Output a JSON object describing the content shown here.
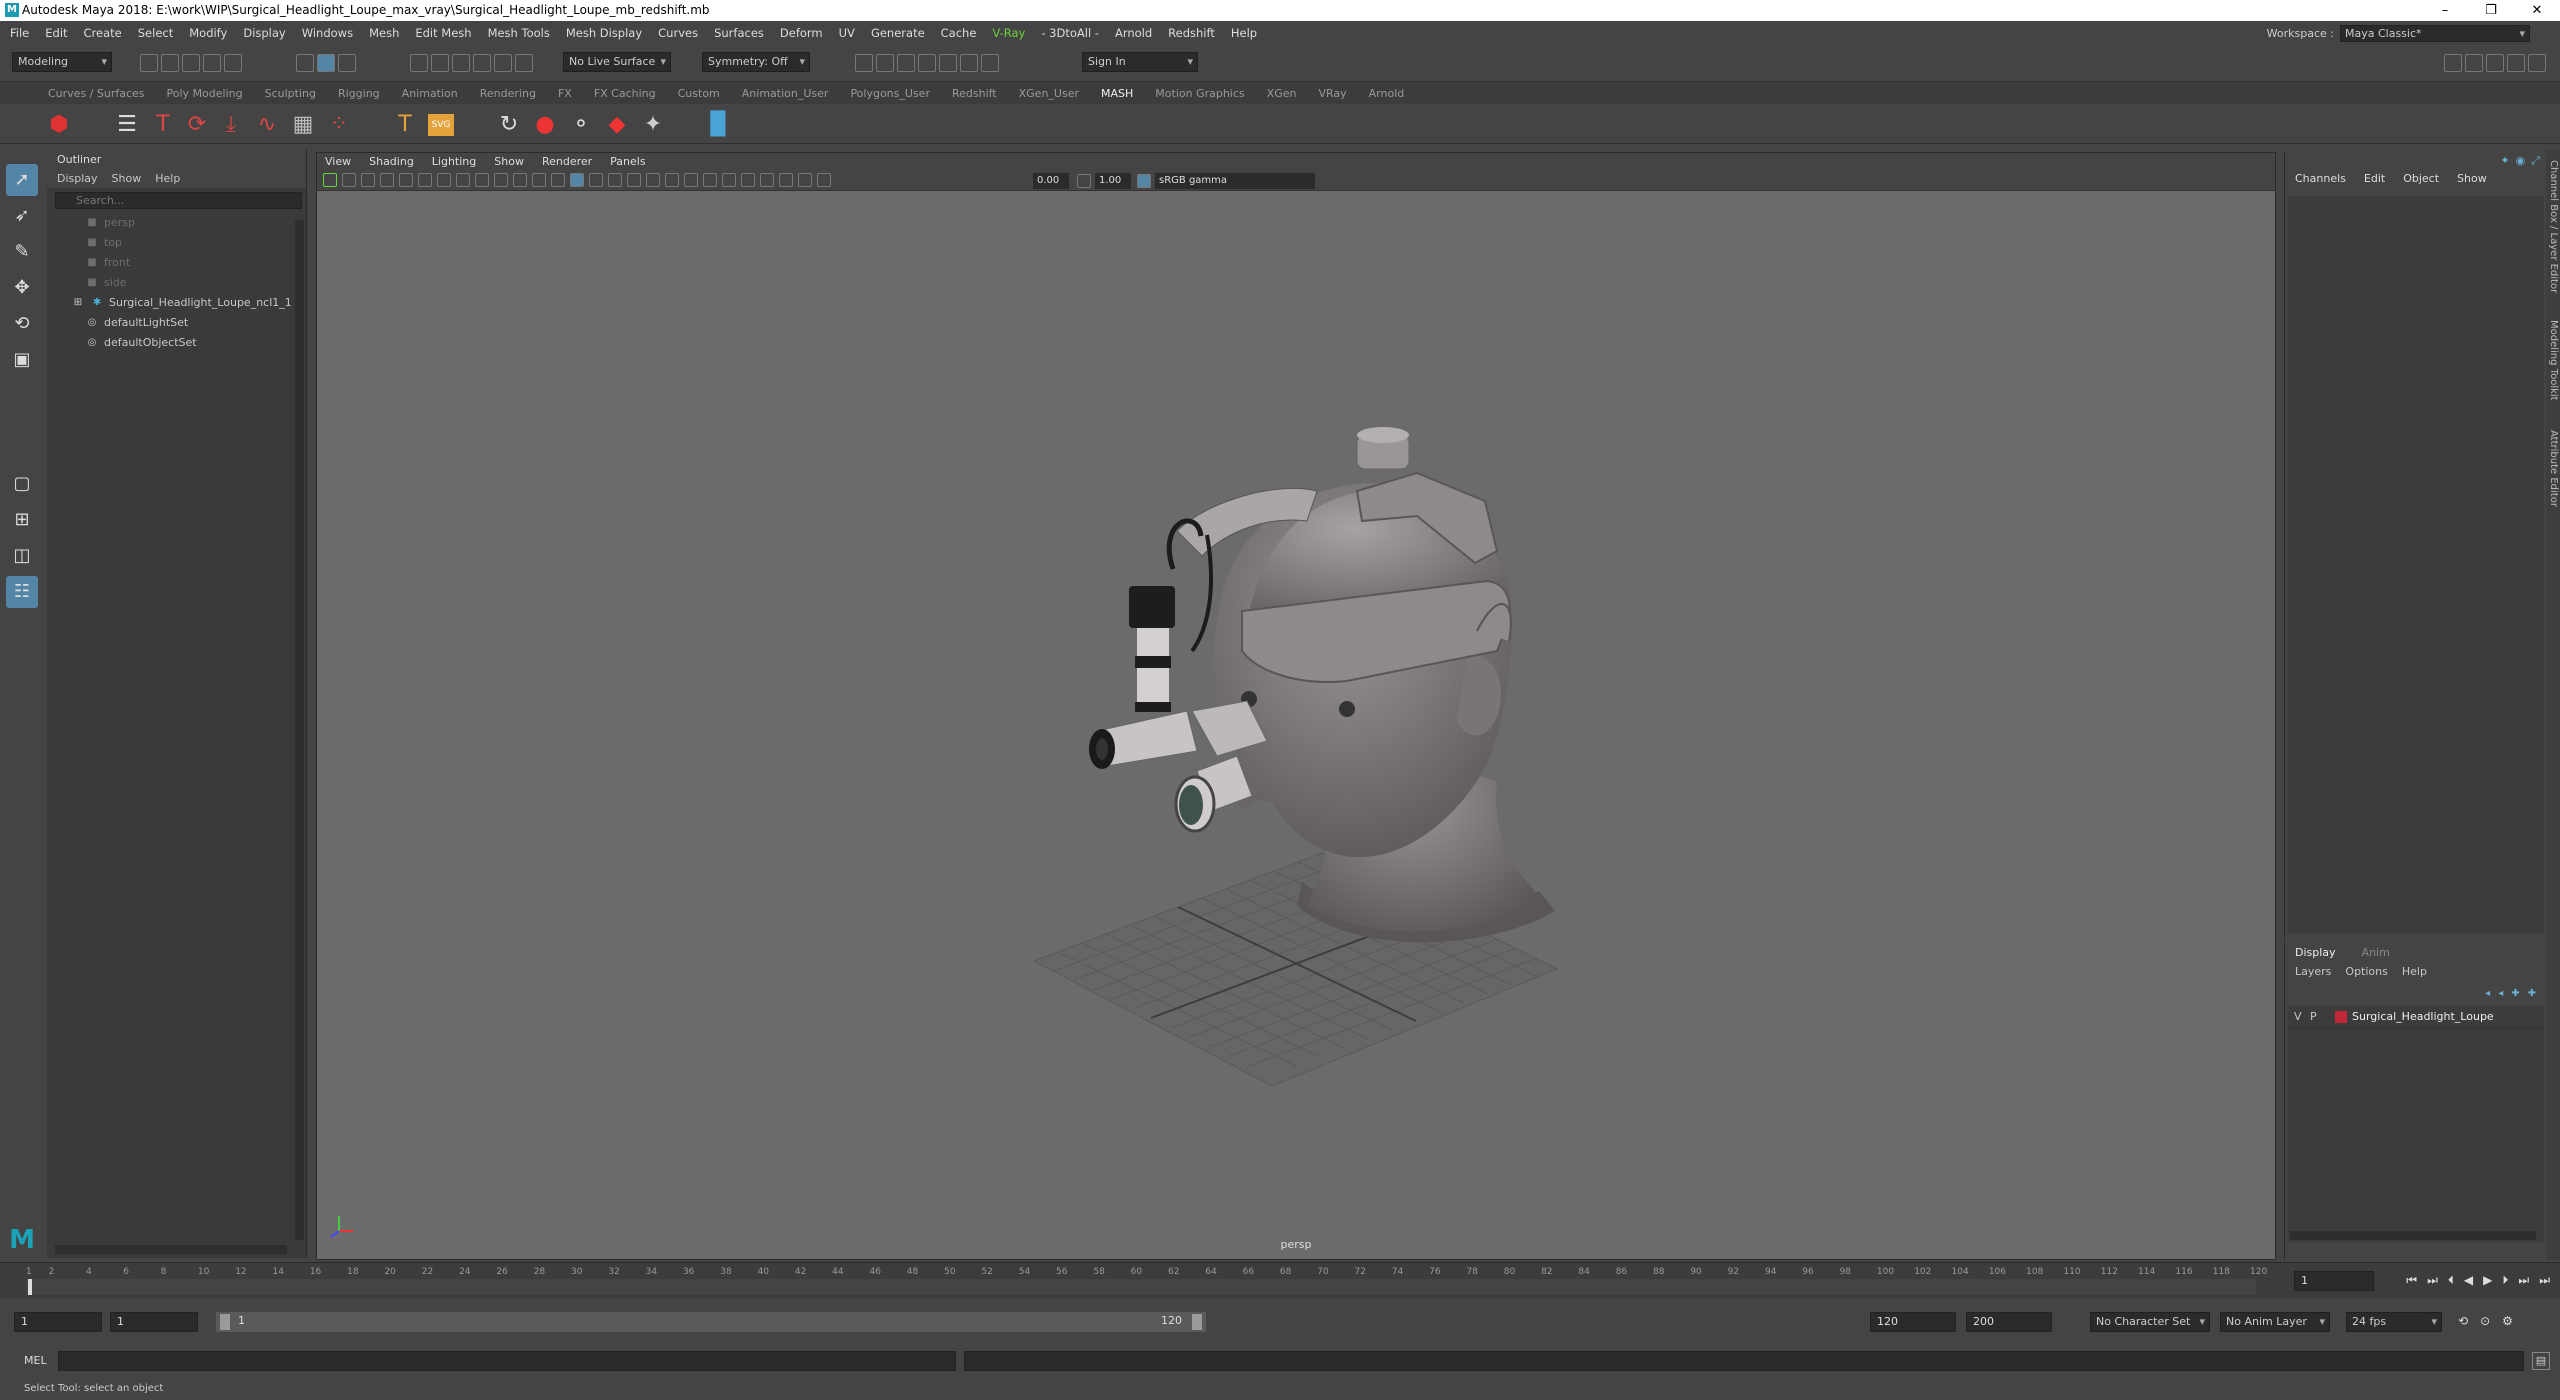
{
  "title_bar": {
    "title": "Autodesk Maya 2018: E:\\work\\WIP\\Surgical_Headlight_Loupe_max_vray\\Surgical_Headlight_Loupe_mb_redshift.mb",
    "minimize": "–",
    "maximize": "❐",
    "close": "✕"
  },
  "menu": [
    "File",
    "Edit",
    "Create",
    "Select",
    "Modify",
    "Display",
    "Windows",
    "Mesh",
    "Edit Mesh",
    "Mesh Tools",
    "Mesh Display",
    "Curves",
    "Surfaces",
    "Deform",
    "UV",
    "Generate",
    "Cache",
    "V-Ray",
    "- 3DtoAll -",
    "Arnold",
    "Redshift",
    "Help"
  ],
  "workspace": {
    "label": "Workspace :",
    "value": "Maya Classic*"
  },
  "status": {
    "mode": "Modeling",
    "live_surface": "No Live Surface",
    "symmetry": "Symmetry: Off",
    "sign_in": "Sign In"
  },
  "shelf_tabs": [
    "Curves / Surfaces",
    "Poly Modeling",
    "Sculpting",
    "Rigging",
    "Animation",
    "Rendering",
    "FX",
    "FX Caching",
    "Custom",
    "Animation_User",
    "Polygons_User",
    "Redshift",
    "XGen_User",
    "MASH",
    "Motion Graphics",
    "XGen",
    "VRay",
    "Arnold"
  ],
  "active_shelf_tab": "MASH",
  "shelf_icon_text": {
    "svg": "SVG"
  },
  "outliner": {
    "title": "Outliner",
    "menu": [
      "Display",
      "Show",
      "Help"
    ],
    "search_placeholder": "Search...",
    "items": [
      {
        "label": "persp",
        "dim": true
      },
      {
        "label": "top",
        "dim": true
      },
      {
        "label": "front",
        "dim": true
      },
      {
        "label": "side",
        "dim": true
      },
      {
        "label": "Surgical_Headlight_Loupe_ncl1_1",
        "dim": false
      },
      {
        "label": "defaultLightSet",
        "dim": false
      },
      {
        "label": "defaultObjectSet",
        "dim": false
      }
    ]
  },
  "viewport": {
    "menu": [
      "View",
      "Shading",
      "Lighting",
      "Show",
      "Renderer",
      "Panels"
    ],
    "exposure": "0.00",
    "gamma": "1.00",
    "color_space": "sRGB gamma",
    "camera_label": "persp"
  },
  "channel_box": {
    "menu": [
      "Channels",
      "Edit",
      "Object",
      "Show"
    ]
  },
  "layer_editor": {
    "tabs": [
      "Display",
      "Anim"
    ],
    "menu": [
      "Layers",
      "Options",
      "Help"
    ],
    "layer": {
      "v": "V",
      "p": "P",
      "name": "Surgical_Headlight_Loupe",
      "color": "#c0283a"
    }
  },
  "side_tabs": [
    "Channel Box / Layer Editor",
    "Modeling Toolkit",
    "Attribute Editor"
  ],
  "timeline": {
    "ticks": [
      "1",
      "2",
      "4",
      "6",
      "8",
      "10",
      "12",
      "14",
      "16",
      "18",
      "20",
      "22",
      "24",
      "26",
      "28",
      "30",
      "32",
      "34",
      "36",
      "38",
      "40",
      "42",
      "44",
      "46",
      "48",
      "50",
      "52",
      "54",
      "56",
      "58",
      "60",
      "62",
      "64",
      "66",
      "68",
      "70",
      "72",
      "74",
      "76",
      "78",
      "80",
      "82",
      "84",
      "86",
      "88",
      "90",
      "92",
      "94",
      "96",
      "98",
      "100",
      "102",
      "104",
      "106",
      "108",
      "110",
      "112",
      "114",
      "116",
      "118",
      "120"
    ],
    "current_frame": "1"
  },
  "range": {
    "start": "1",
    "playback_start": "1",
    "range_start_label": "1",
    "range_end_label": "120",
    "playback_end": "120",
    "end": "200",
    "character_set": "No Character Set",
    "anim_layer": "No Anim Layer",
    "fps": "24 fps"
  },
  "command": {
    "label": "MEL"
  },
  "help_line": "Select Tool: select an object",
  "accent": "#5285a6"
}
